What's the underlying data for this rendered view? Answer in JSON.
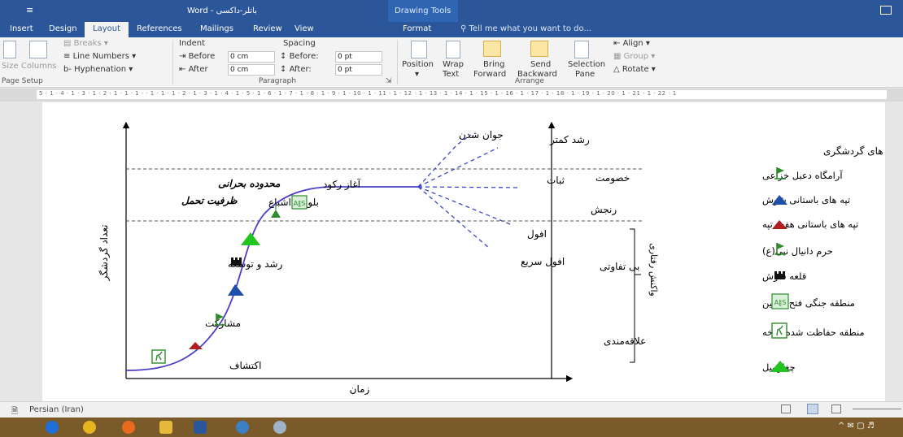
{
  "window": {
    "title": "Word - باتلر-داکسی",
    "quick_access": "≡",
    "contextual_group": "Drawing Tools"
  },
  "tabs": [
    "Insert",
    "Design",
    "Layout",
    "References",
    "Mailings",
    "Review",
    "View",
    "Format"
  ],
  "tell_me": "Tell me what you want to do...",
  "ribbon": {
    "page_setup": {
      "size": "Size",
      "columns": "Columns",
      "breaks": "Breaks",
      "line_numbers": "Line Numbers",
      "hyphenation": "Hyphenation",
      "group_label": "Page Setup"
    },
    "paragraph": {
      "indent_label": "Indent",
      "spacing_label": "Spacing",
      "before_label": "Before",
      "after_label": "After",
      "indent_before": "0 cm",
      "indent_after": "0 cm",
      "spacing_before_label": "Before:",
      "spacing_after_label": "After:",
      "spacing_before": "0 pt",
      "spacing_after": "0 pt",
      "group_label": "Paragraph"
    },
    "arrange": {
      "position": "Position",
      "wrap_text": [
        "Wrap",
        "Text"
      ],
      "bring_forward": [
        "Bring",
        "Forward"
      ],
      "send_backward": [
        "Send",
        "Backward"
      ],
      "selection_pane": [
        "Selection",
        "Pane"
      ],
      "align": "Align",
      "group": "Group",
      "rotate": "Rotate",
      "group_label": "Arrange"
    }
  },
  "ruler_text": "5 · 1 · 4 · 1 · 3 · 1 · 2 · 1 · 1 · 1 · · 1 · 1 · 1 · 2 · 1 · 3 · 1 · 4 · 1 · 5 · 1 · 6 · 1 · 7 · 1 · 8 · 1 · 9 · 1 · 10 · 1 · 11 · 1 · 12 · 1 · 13 · 1 · 14 · 1 · 15 · 1 · 16 · 1 · 17 · 1 · 18 · 1 · 19 · 1 · 20 · 1 · 21 · 1 · 22 · 1",
  "diagram": {
    "x_axis_label": "زمان",
    "y_axis_label": "تعداد گردشگر",
    "curve_labels": {
      "discovery": "اکتشاف",
      "participation": "مشارکت",
      "growth": "رشد و توسعه",
      "maturity": "بلوغ و اشباع",
      "stagnation": "آغاز رکود",
      "critical_zone": "محدوده بحرانی",
      "capacity": "ظرفیت تحمل"
    },
    "scenarios": {
      "rejuvenation": "جوان شدن",
      "reduced_growth": "رشد کمتر",
      "stabilization": "ثبات",
      "decline": "افول",
      "rapid_decline": "افول سریع"
    },
    "reactions": {
      "hostility": "خصومت",
      "annoyance": "رنجش",
      "indifference": "بی تفاوتی",
      "interest": "علاقه‌مندی",
      "bracket_label": "واکنش رفتاری"
    },
    "legend_title": "محوطه های گردشگری",
    "legend": [
      {
        "label": "آرامگاه دعبل خزاعی",
        "icon": "green-flag-icon",
        "color": "#2e8b2e"
      },
      {
        "label": "تپه های باستانی شوش",
        "icon": "blue-tent-icon",
        "color": "#1f4fa8"
      },
      {
        "label": "تپه های باستانی هفت تپه",
        "icon": "red-tent-icon",
        "color": "#b01e1e"
      },
      {
        "label": "حرم دانیال نبی(ع)",
        "icon": "green-shrine-flag-icon",
        "color": "#2e8b2e"
      },
      {
        "label": "قلعه شوش",
        "icon": "castle-icon",
        "color": "#111111"
      },
      {
        "label": "منطقه جنگی فتح المبین",
        "icon": "monument-icon",
        "color": "#2e8b2e"
      },
      {
        "label": "منطقه حفاظت شده کرخه",
        "icon": "deer-icon",
        "color": "#2e8b2e"
      },
      {
        "label": "چغازنبیل",
        "icon": "green-triangle-icon",
        "color": "#22c422"
      }
    ],
    "curve_color": "#4a3ec9",
    "dashed_color": "#3a48c8"
  },
  "status": {
    "language": "Persian (Iran)"
  }
}
